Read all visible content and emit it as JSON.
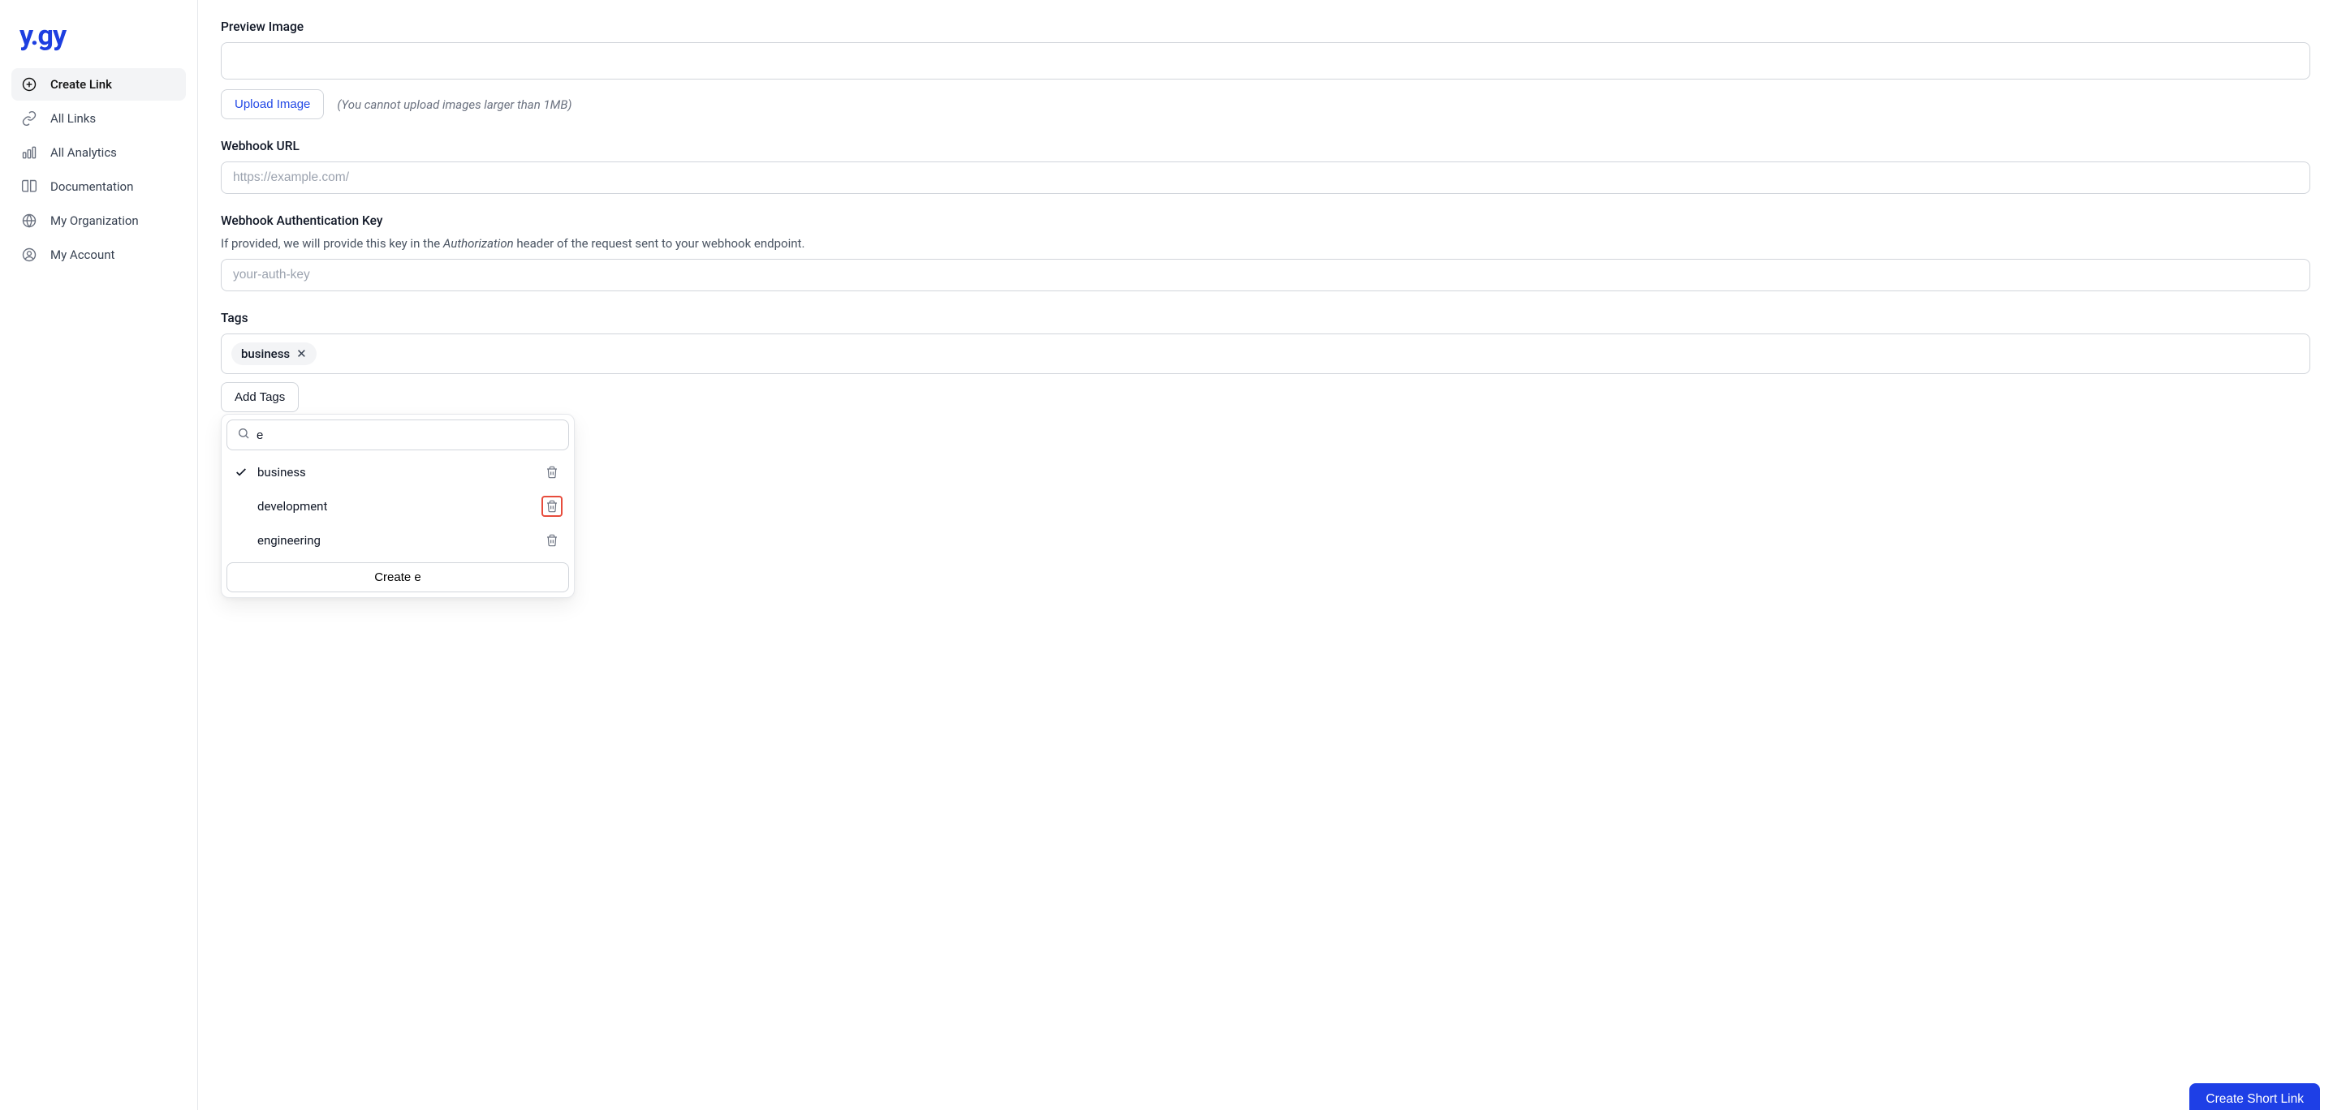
{
  "logo": "y.gy",
  "sidebar": {
    "items": [
      {
        "label": "Create Link"
      },
      {
        "label": "All Links"
      },
      {
        "label": "All Analytics"
      },
      {
        "label": "Documentation"
      },
      {
        "label": "My Organization"
      },
      {
        "label": "My Account"
      }
    ]
  },
  "preview_image": {
    "label": "Preview Image",
    "upload_label": "Upload Image",
    "note": "(You cannot upload images larger than 1MB)"
  },
  "webhook_url": {
    "label": "Webhook URL",
    "placeholder": "https://example.com/"
  },
  "webhook_auth": {
    "label": "Webhook Authentication Key",
    "help_pre": "If provided, we will provide this key in the ",
    "help_em": "Authorization",
    "help_post": " header of the request sent to your webhook endpoint.",
    "placeholder": "your-auth-key"
  },
  "tags": {
    "label": "Tags",
    "selected": [
      "business"
    ],
    "add_label": "Add Tags",
    "search_value": "e",
    "options": [
      {
        "label": "business",
        "checked": true,
        "highlight": false
      },
      {
        "label": "development",
        "checked": false,
        "highlight": true
      },
      {
        "label": "engineering",
        "checked": false,
        "highlight": false
      }
    ],
    "create_label": "Create e"
  },
  "footer": {
    "create_short_link": "Create Short Link"
  }
}
